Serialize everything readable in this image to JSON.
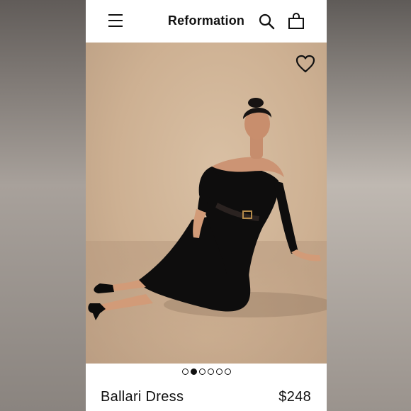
{
  "header": {
    "brand": "Reformation",
    "icons": [
      "menu-icon",
      "search-icon",
      "shopping-bag-icon"
    ]
  },
  "gallery": {
    "image_alt": "Model wearing black off-shoulder long sleeve dress with belt, seated on floor",
    "favorite_icon": "heart-outline-icon",
    "total_images": 6,
    "active_index": 1
  },
  "product": {
    "name": "Ballari Dress",
    "price": "$248"
  },
  "colors": {
    "backdrop": "#d2b79b",
    "dress": "#0e0d0d",
    "text": "#111111"
  }
}
